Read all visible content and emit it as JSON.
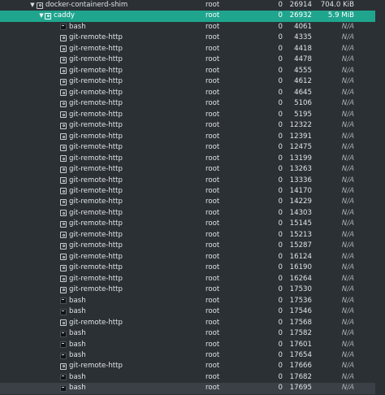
{
  "processes": [
    {
      "name": "docker-containerd-shim",
      "user": "root",
      "nice": "0",
      "pid": "26914",
      "mem": "704.0 KiB",
      "icon": "process-icon",
      "expand": "▼",
      "state": "normal"
    },
    {
      "name": "caddy",
      "user": "root",
      "nice": "0",
      "pid": "26932",
      "mem": "5.9 MiB",
      "icon": "process-icon",
      "expand": "▼",
      "state": "selected"
    },
    {
      "name": "bash",
      "user": "root",
      "nice": "0",
      "pid": "4061",
      "mem": "N/A",
      "icon": "terminal-icon",
      "state": "normal"
    },
    {
      "name": "git-remote-http",
      "user": "root",
      "nice": "0",
      "pid": "4335",
      "mem": "N/A",
      "icon": "process-icon",
      "state": "normal"
    },
    {
      "name": "git-remote-http",
      "user": "root",
      "nice": "0",
      "pid": "4418",
      "mem": "N/A",
      "icon": "process-icon",
      "state": "normal"
    },
    {
      "name": "git-remote-http",
      "user": "root",
      "nice": "0",
      "pid": "4478",
      "mem": "N/A",
      "icon": "process-icon",
      "state": "normal"
    },
    {
      "name": "git-remote-http",
      "user": "root",
      "nice": "0",
      "pid": "4555",
      "mem": "N/A",
      "icon": "process-icon",
      "state": "normal"
    },
    {
      "name": "git-remote-http",
      "user": "root",
      "nice": "0",
      "pid": "4612",
      "mem": "N/A",
      "icon": "process-icon",
      "state": "normal"
    },
    {
      "name": "git-remote-http",
      "user": "root",
      "nice": "0",
      "pid": "4645",
      "mem": "N/A",
      "icon": "process-icon",
      "state": "normal"
    },
    {
      "name": "git-remote-http",
      "user": "root",
      "nice": "0",
      "pid": "5106",
      "mem": "N/A",
      "icon": "process-icon",
      "state": "normal"
    },
    {
      "name": "git-remote-http",
      "user": "root",
      "nice": "0",
      "pid": "5195",
      "mem": "N/A",
      "icon": "process-icon",
      "state": "normal"
    },
    {
      "name": "git-remote-http",
      "user": "root",
      "nice": "0",
      "pid": "12322",
      "mem": "N/A",
      "icon": "process-icon",
      "state": "normal"
    },
    {
      "name": "git-remote-http",
      "user": "root",
      "nice": "0",
      "pid": "12391",
      "mem": "N/A",
      "icon": "process-icon",
      "state": "normal"
    },
    {
      "name": "git-remote-http",
      "user": "root",
      "nice": "0",
      "pid": "12475",
      "mem": "N/A",
      "icon": "process-icon",
      "state": "normal"
    },
    {
      "name": "git-remote-http",
      "user": "root",
      "nice": "0",
      "pid": "13199",
      "mem": "N/A",
      "icon": "process-icon",
      "state": "normal"
    },
    {
      "name": "git-remote-http",
      "user": "root",
      "nice": "0",
      "pid": "13263",
      "mem": "N/A",
      "icon": "process-icon",
      "state": "normal"
    },
    {
      "name": "git-remote-http",
      "user": "root",
      "nice": "0",
      "pid": "13336",
      "mem": "N/A",
      "icon": "process-icon",
      "state": "normal"
    },
    {
      "name": "git-remote-http",
      "user": "root",
      "nice": "0",
      "pid": "14170",
      "mem": "N/A",
      "icon": "process-icon",
      "state": "normal"
    },
    {
      "name": "git-remote-http",
      "user": "root",
      "nice": "0",
      "pid": "14229",
      "mem": "N/A",
      "icon": "process-icon",
      "state": "normal"
    },
    {
      "name": "git-remote-http",
      "user": "root",
      "nice": "0",
      "pid": "14303",
      "mem": "N/A",
      "icon": "process-icon",
      "state": "normal"
    },
    {
      "name": "git-remote-http",
      "user": "root",
      "nice": "0",
      "pid": "15145",
      "mem": "N/A",
      "icon": "process-icon",
      "state": "normal"
    },
    {
      "name": "git-remote-http",
      "user": "root",
      "nice": "0",
      "pid": "15213",
      "mem": "N/A",
      "icon": "process-icon",
      "state": "normal"
    },
    {
      "name": "git-remote-http",
      "user": "root",
      "nice": "0",
      "pid": "15287",
      "mem": "N/A",
      "icon": "process-icon",
      "state": "normal"
    },
    {
      "name": "git-remote-http",
      "user": "root",
      "nice": "0",
      "pid": "16124",
      "mem": "N/A",
      "icon": "process-icon",
      "state": "normal"
    },
    {
      "name": "git-remote-http",
      "user": "root",
      "nice": "0",
      "pid": "16190",
      "mem": "N/A",
      "icon": "process-icon",
      "state": "normal"
    },
    {
      "name": "git-remote-http",
      "user": "root",
      "nice": "0",
      "pid": "16264",
      "mem": "N/A",
      "icon": "process-icon",
      "state": "normal"
    },
    {
      "name": "git-remote-http",
      "user": "root",
      "nice": "0",
      "pid": "17530",
      "mem": "N/A",
      "icon": "process-icon",
      "state": "normal"
    },
    {
      "name": "bash",
      "user": "root",
      "nice": "0",
      "pid": "17536",
      "mem": "N/A",
      "icon": "terminal-icon",
      "state": "normal"
    },
    {
      "name": "bash",
      "user": "root",
      "nice": "0",
      "pid": "17546",
      "mem": "N/A",
      "icon": "terminal-icon",
      "state": "normal"
    },
    {
      "name": "git-remote-http",
      "user": "root",
      "nice": "0",
      "pid": "17568",
      "mem": "N/A",
      "icon": "process-icon",
      "state": "normal"
    },
    {
      "name": "bash",
      "user": "root",
      "nice": "0",
      "pid": "17582",
      "mem": "N/A",
      "icon": "terminal-icon",
      "state": "normal"
    },
    {
      "name": "bash",
      "user": "root",
      "nice": "0",
      "pid": "17601",
      "mem": "N/A",
      "icon": "terminal-icon",
      "state": "normal"
    },
    {
      "name": "bash",
      "user": "root",
      "nice": "0",
      "pid": "17654",
      "mem": "N/A",
      "icon": "terminal-icon",
      "state": "normal"
    },
    {
      "name": "git-remote-http",
      "user": "root",
      "nice": "0",
      "pid": "17666",
      "mem": "N/A",
      "icon": "process-icon",
      "state": "normal"
    },
    {
      "name": "bash",
      "user": "root",
      "nice": "0",
      "pid": "17682",
      "mem": "N/A",
      "icon": "terminal-icon",
      "state": "normal"
    },
    {
      "name": "bash",
      "user": "root",
      "nice": "0",
      "pid": "17695",
      "mem": "N/A",
      "icon": "terminal-icon",
      "state": "hover"
    }
  ],
  "colors": {
    "background": "#2b3035",
    "selected": "#1fa58e",
    "hover": "#3a4046",
    "text": "#dfe3e6"
  }
}
